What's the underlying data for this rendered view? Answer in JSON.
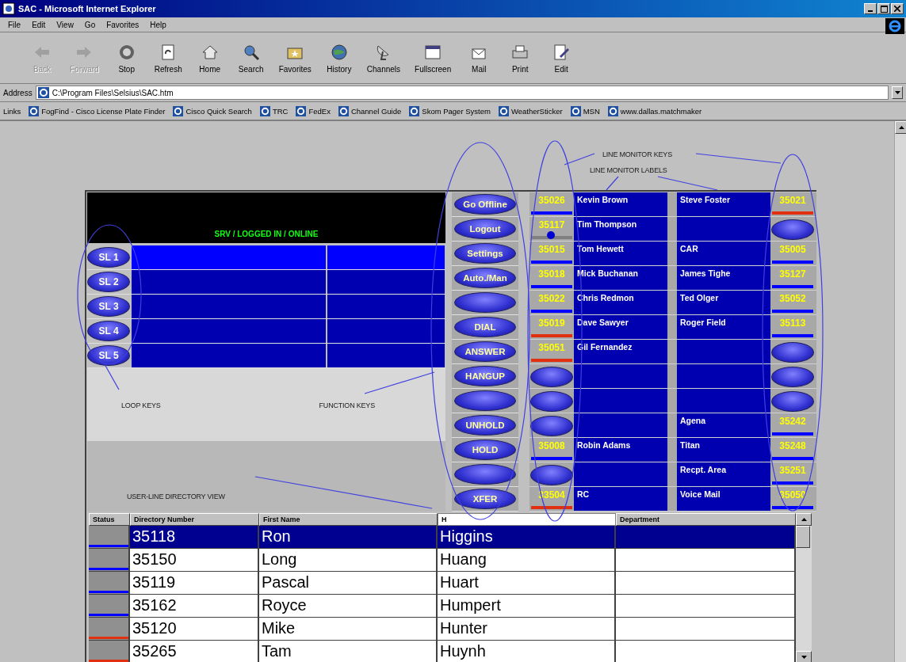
{
  "window": {
    "title": "SAC - Microsoft Internet Explorer"
  },
  "menu": [
    "File",
    "Edit",
    "View",
    "Go",
    "Favorites",
    "Help"
  ],
  "toolbar": [
    {
      "kind": "back",
      "label": "Back",
      "disabled": true
    },
    {
      "kind": "forward",
      "label": "Forward",
      "disabled": true
    },
    {
      "kind": "stop",
      "label": "Stop",
      "disabled": false
    },
    {
      "kind": "refresh",
      "label": "Refresh",
      "disabled": false
    },
    {
      "kind": "home",
      "label": "Home",
      "disabled": false
    },
    {
      "kind": "search",
      "label": "Search",
      "disabled": false
    },
    {
      "kind": "favorites",
      "label": "Favorites",
      "disabled": false
    },
    {
      "kind": "history",
      "label": "History",
      "disabled": false
    },
    {
      "kind": "channels",
      "label": "Channels",
      "disabled": false
    },
    {
      "kind": "fullscreen",
      "label": "Fullscreen",
      "disabled": false
    },
    {
      "kind": "mail",
      "label": "Mail",
      "disabled": false
    },
    {
      "kind": "print",
      "label": "Print",
      "disabled": false
    },
    {
      "kind": "edit",
      "label": "Edit",
      "disabled": false
    }
  ],
  "address": {
    "label": "Address",
    "value": "C:\\Program Files\\Selsius\\SAC.htm"
  },
  "links": {
    "label": "Links",
    "items": [
      "FogFind - Cisco License Plate Finder",
      "Cisco Quick Search",
      "TRC",
      "FedEx",
      "Channel Guide",
      "Skom Pager System",
      "WeatherSticker",
      "MSN",
      "www.dallas.matchmaker"
    ]
  },
  "annotations": {
    "line_monitor_keys": "LINE MONITOR KEYS",
    "line_monitor_labels": "LINE MONITOR LABELS",
    "loop_keys": "LOOP KEYS",
    "function_keys": "FUNCTION KEYS",
    "directory_view": "USER-LINE DIRECTORY VIEW"
  },
  "display": {
    "status": "SRV / LOGGED IN / ONLINE"
  },
  "loop_keys": [
    {
      "label": "SL 1",
      "selected": true
    },
    {
      "label": "SL 2",
      "selected": false
    },
    {
      "label": "SL 3",
      "selected": false
    },
    {
      "label": "SL 4",
      "selected": false
    },
    {
      "label": "SL 5",
      "selected": false
    }
  ],
  "function_keys": [
    {
      "kind": "labeled",
      "label": "Go Offline"
    },
    {
      "kind": "labeled",
      "label": "Logout"
    },
    {
      "kind": "labeled",
      "label": "Settings"
    },
    {
      "kind": "labeled",
      "label": "Auto./Man"
    },
    {
      "kind": "blank"
    },
    {
      "kind": "labeled",
      "label": "DIAL"
    },
    {
      "kind": "labeled",
      "label": "ANSWER"
    },
    {
      "kind": "labeled",
      "label": "HANGUP"
    },
    {
      "kind": "blank"
    },
    {
      "kind": "labeled",
      "label": "UNHOLD"
    },
    {
      "kind": "labeled",
      "label": "HOLD"
    },
    {
      "kind": "blank"
    },
    {
      "kind": "labeled",
      "label": "XFER"
    }
  ],
  "line_monitor": [
    {
      "left_key": {
        "kind": "number",
        "number": "35026",
        "color": "#0000ff",
        "lit": false
      },
      "left_label": "Kevin Brown",
      "right_label": "Steve Foster",
      "right_key": {
        "kind": "number",
        "number": "35021",
        "color": "#e03010",
        "lit": false
      }
    },
    {
      "left_key": {
        "kind": "number",
        "number": "35117",
        "color": "#808080",
        "lit": true
      },
      "left_label": "Tim Thompson",
      "right_key": {
        "kind": "blank"
      }
    },
    {
      "left_key": {
        "kind": "number",
        "number": "35015",
        "color": "#0000ff",
        "lit": false
      },
      "left_label": "Tom Hewett",
      "right_label": "CAR",
      "right_key": {
        "kind": "number",
        "number": "35005",
        "color": "#0000ff",
        "lit": false
      }
    },
    {
      "left_key": {
        "kind": "number",
        "number": "35018",
        "color": "#0000ff",
        "lit": false
      },
      "left_label": "Mick Buchanan",
      "right_label": "James Tighe",
      "right_key": {
        "kind": "number",
        "number": "35127",
        "color": "#0000ff",
        "lit": false
      }
    },
    {
      "left_key": {
        "kind": "number",
        "number": "35022",
        "color": "#0000ff",
        "lit": false
      },
      "left_label": "Chris Redmon",
      "right_label": "Ted Olger",
      "right_key": {
        "kind": "number",
        "number": "35052",
        "color": "#0000ff",
        "lit": false
      }
    },
    {
      "left_key": {
        "kind": "number",
        "number": "35019",
        "color": "#e03010",
        "lit": false
      },
      "left_label": "Dave Sawyer",
      "right_label": "Roger Field",
      "right_key": {
        "kind": "number",
        "number": "35113",
        "color": "#0000ff",
        "lit": false
      }
    },
    {
      "left_key": {
        "kind": "number",
        "number": "35051",
        "color": "#e03010",
        "lit": false
      },
      "left_label": "Gil Fernandez",
      "right_key": {
        "kind": "blank"
      }
    },
    {
      "left_key": {
        "kind": "blank"
      },
      "right_key": {
        "kind": "blank"
      }
    },
    {
      "left_key": {
        "kind": "blank"
      },
      "right_key": {
        "kind": "blank"
      }
    },
    {
      "left_key": {
        "kind": "blank"
      },
      "right_label": "Agena",
      "right_key": {
        "kind": "number",
        "number": "35242",
        "color": "#0000ff",
        "lit": false
      }
    },
    {
      "left_key": {
        "kind": "number",
        "number": "35008",
        "color": "#0000ff",
        "lit": false
      },
      "left_label": "Robin Adams",
      "right_label": "Titan",
      "right_key": {
        "kind": "number",
        "number": "35248",
        "color": "#0000ff",
        "lit": false
      }
    },
    {
      "left_key": {
        "kind": "blank"
      },
      "right_label": "Recpt. Area",
      "right_key": {
        "kind": "number",
        "number": "35251",
        "color": "#0000ff",
        "lit": false
      }
    },
    {
      "left_key": {
        "kind": "number",
        "number": "33504",
        "color": "#e03010",
        "lit": false
      },
      "left_label": "RC",
      "right_label": "Voice Mail",
      "right_key": {
        "kind": "number",
        "number": "35050",
        "color": "#0000ff",
        "lit": false
      }
    }
  ],
  "directory": {
    "columns": [
      {
        "kind": "header",
        "label": "Status"
      },
      {
        "kind": "header",
        "label": "Directory Number"
      },
      {
        "kind": "header",
        "label": "First Name"
      },
      {
        "kind": "filter",
        "value": "H"
      },
      {
        "kind": "header",
        "label": "Department"
      }
    ],
    "rows": [
      {
        "color": "#0000ff",
        "number": "35118",
        "first_name": "Ron",
        "last_name": "Higgins",
        "selected": true
      },
      {
        "color": "#0000ff",
        "number": "35150",
        "first_name": "Long",
        "last_name": "Huang",
        "selected": false
      },
      {
        "color": "#0000ff",
        "number": "35119",
        "first_name": "Pascal",
        "last_name": "Huart",
        "selected": false
      },
      {
        "color": "#0000ff",
        "number": "35162",
        "first_name": "Royce",
        "last_name": "Humpert",
        "selected": false
      },
      {
        "color": "#e03010",
        "number": "35120",
        "first_name": "Mike",
        "last_name": "Hunter",
        "selected": false
      },
      {
        "color": "#e03010",
        "number": "35265",
        "first_name": "Tam",
        "last_name": "Huynh",
        "selected": false
      }
    ]
  }
}
